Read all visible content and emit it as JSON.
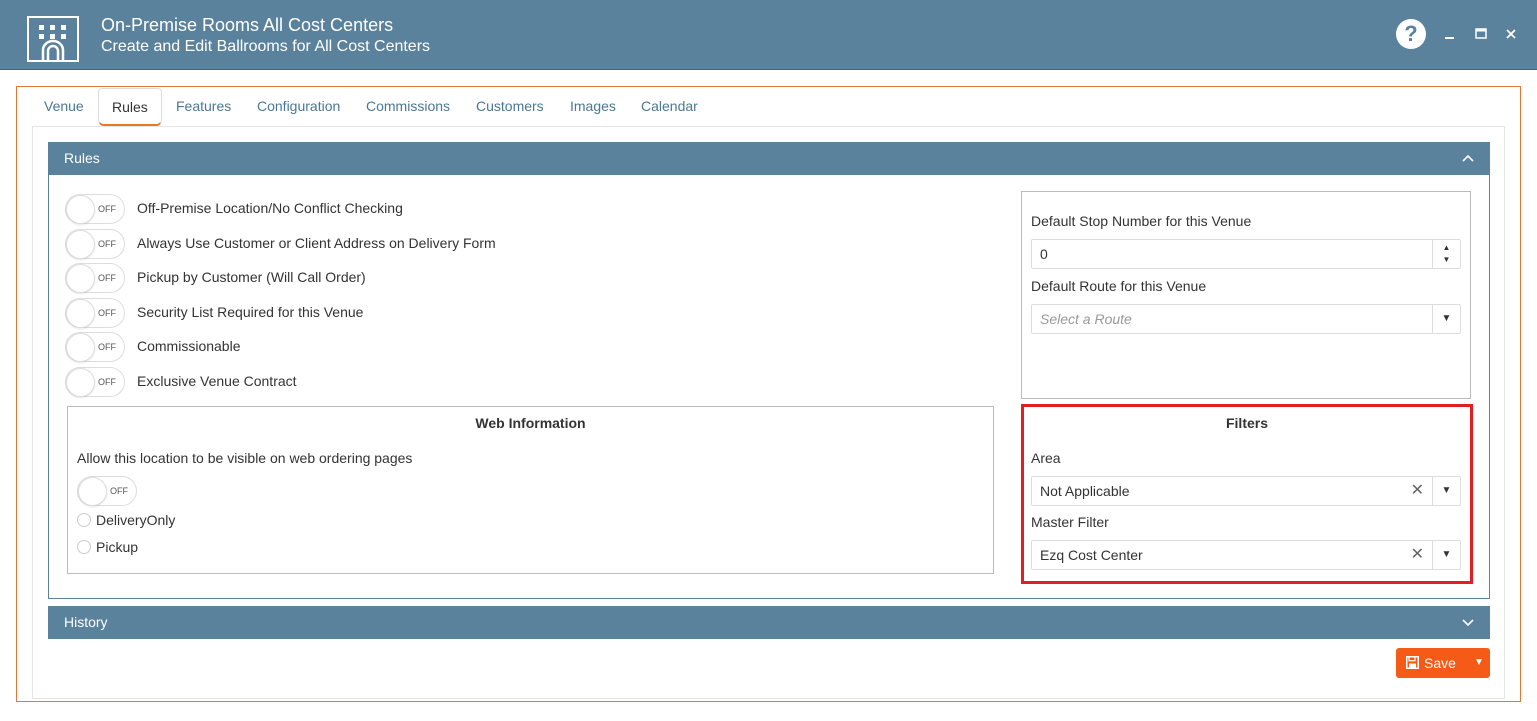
{
  "header": {
    "title": "On-Premise Rooms All Cost Centers",
    "subtitle": "Create and Edit Ballrooms for All Cost Centers",
    "help_label": "?"
  },
  "tabs": [
    {
      "label": "Venue"
    },
    {
      "label": "Rules",
      "active": true
    },
    {
      "label": "Features"
    },
    {
      "label": "Configuration"
    },
    {
      "label": "Commissions"
    },
    {
      "label": "Customers"
    },
    {
      "label": "Images"
    },
    {
      "label": "Calendar"
    }
  ],
  "rules_panel": {
    "title": "Rules",
    "toggles": [
      {
        "label": "Off-Premise Location/No Conflict Checking",
        "state": "OFF"
      },
      {
        "label": "Always Use Customer or Client Address on Delivery Form",
        "state": "OFF"
      },
      {
        "label": "Pickup by Customer (Will Call Order)",
        "state": "OFF"
      },
      {
        "label": "Security List Required for this Venue",
        "state": "OFF"
      },
      {
        "label": "Commissionable",
        "state": "OFF"
      },
      {
        "label": "Exclusive Venue Contract",
        "state": "OFF"
      }
    ]
  },
  "web_information": {
    "title": "Web Information",
    "visible_label": "Allow this location to be visible on web ordering pages",
    "toggle_state": "OFF",
    "options": [
      "DeliveryOnly",
      "Pickup"
    ]
  },
  "route_settings": {
    "stop_number_label": "Default Stop Number for this Venue",
    "stop_number_value": "0",
    "route_label": "Default Route for this Venue",
    "route_placeholder": "Select a Route"
  },
  "filters": {
    "title": "Filters",
    "area_label": "Area",
    "area_value": "Not Applicable",
    "master_filter_label": "Master Filter",
    "master_filter_value": "Ezq Cost Center",
    "highlight_color": "#e02020"
  },
  "history_panel": {
    "title": "History"
  },
  "actions": {
    "save_label": "Save"
  },
  "colors": {
    "header": "#5a829c",
    "accent": "#e87722",
    "save_button": "#f55a16"
  }
}
